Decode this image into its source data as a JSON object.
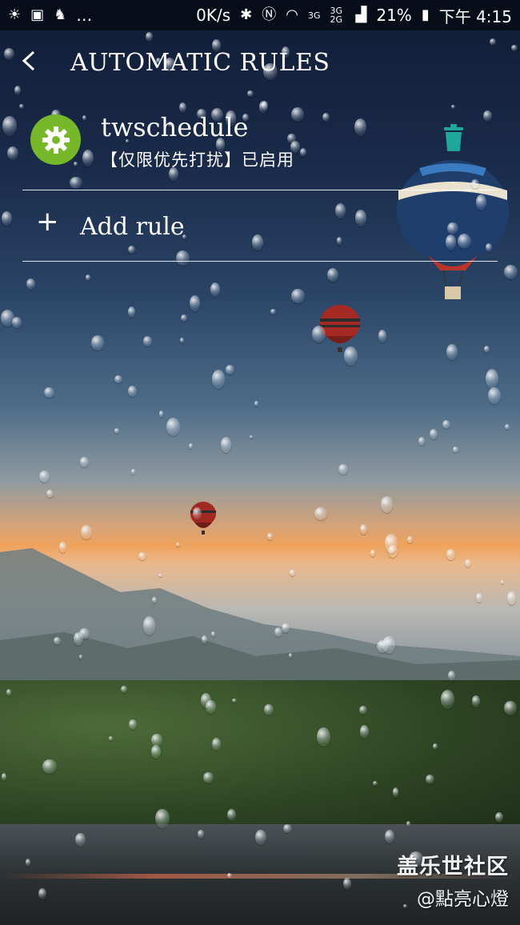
{
  "status_bar": {
    "icons_left": [
      "weather-sun-cloud-icon",
      "image-icon",
      "notification-icon"
    ],
    "overflow": "…",
    "network_speed": "0K/s",
    "network_type_1": "3G",
    "network_type_2": "3G 2G",
    "battery_percent": "21%",
    "time": "下午 4:15"
  },
  "header": {
    "title": "AUTOMATIC RULES"
  },
  "rules": [
    {
      "name": "twschedule",
      "status": "【仅限优先打扰】已启用",
      "icon": "gear-icon",
      "icon_color": "#76b82a"
    }
  ],
  "add_rule": {
    "label": "Add rule"
  },
  "colors": {
    "accent_green": "#76b82a",
    "trash_teal": "#1fa89a"
  },
  "watermark": {
    "logo": "盖乐世社区",
    "user": "@點亮心燈"
  }
}
